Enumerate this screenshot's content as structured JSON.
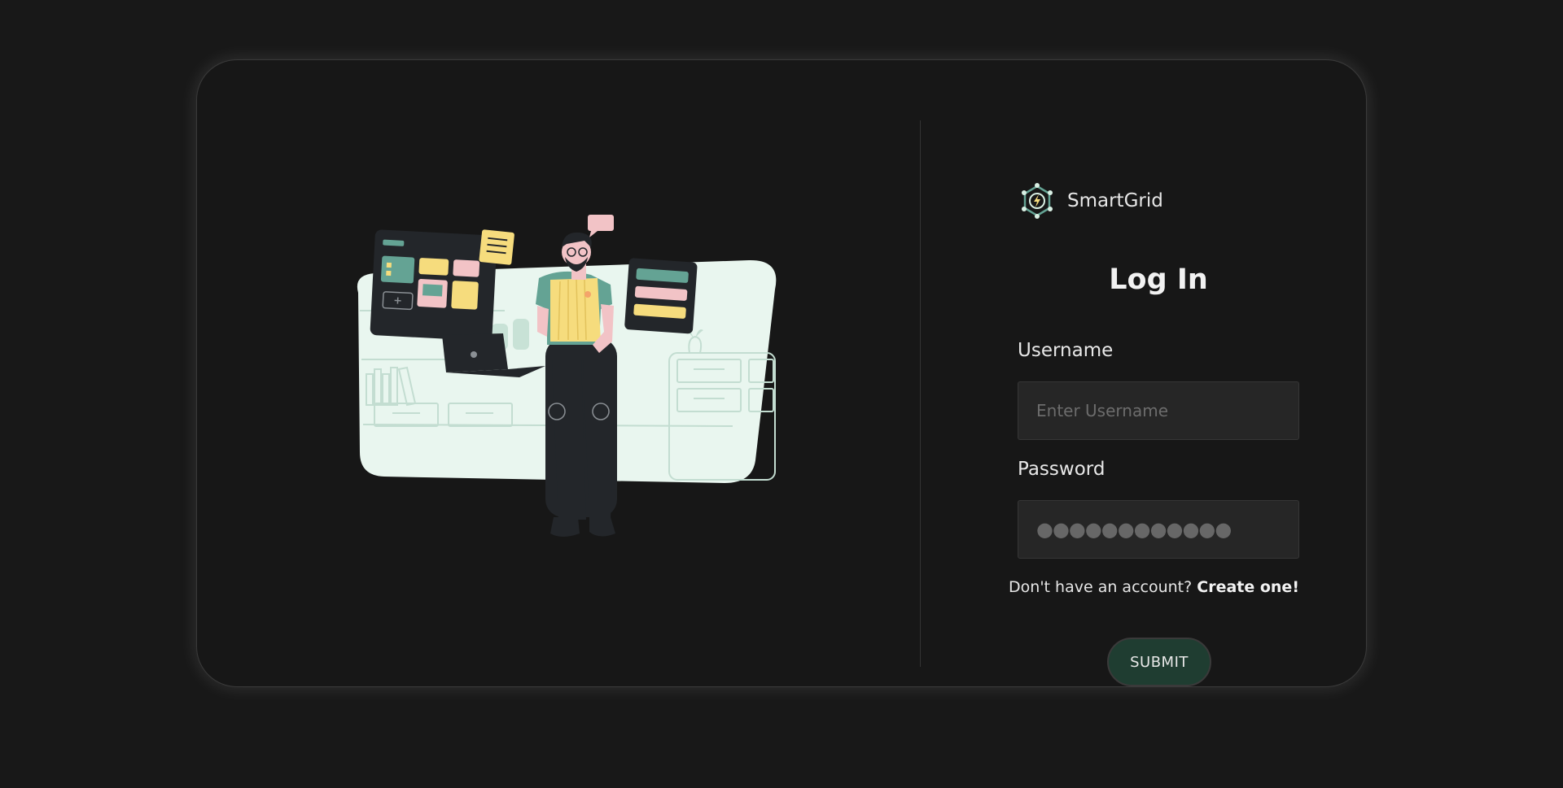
{
  "brand": {
    "name": "SmartGrid",
    "logo_icon": "circuit-lightning-icon"
  },
  "form": {
    "title": "Log In",
    "username_label": "Username",
    "username_placeholder": "Enter Username",
    "username_value": "",
    "password_label": "Password",
    "password_value": "●●●●●●●●●●●●",
    "signup_prompt": "Don't have an account?",
    "signup_link": "Create one!",
    "submit_label": "SUBMIT"
  },
  "colors": {
    "background": "#181818",
    "card": "#171717",
    "accent_green": "#1f3d31",
    "illustration_panel": "#e9f6ef",
    "teal": "#64a394",
    "yellow": "#f6dc7d",
    "pink": "#f2c3c6"
  },
  "illustration": {
    "icon": "person-with-dashboard-illustration"
  }
}
